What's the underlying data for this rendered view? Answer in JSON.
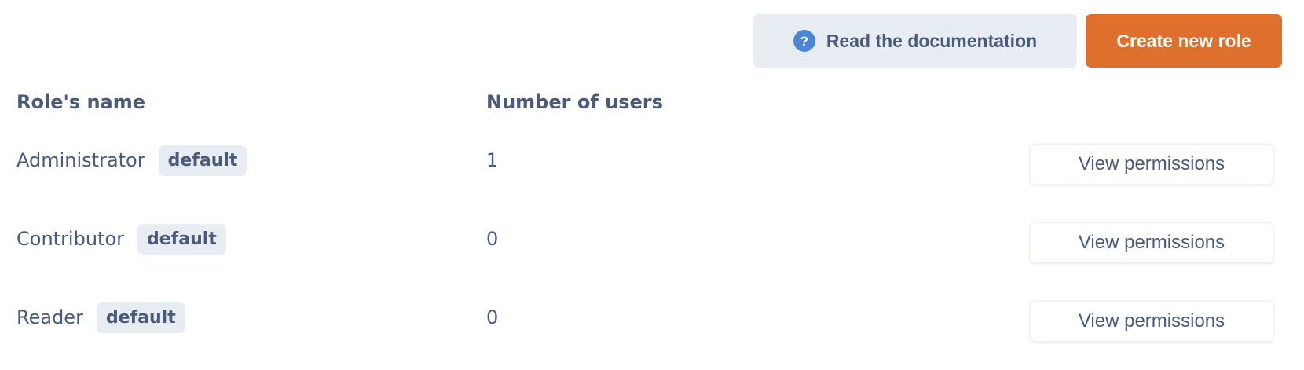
{
  "toolbar": {
    "documentation_label": "Read the documentation",
    "documentation_icon": "help-circle-icon",
    "documentation_icon_glyph": "?",
    "create_label": "Create new role"
  },
  "table": {
    "headers": {
      "name": "Role's name",
      "users": "Number of users"
    },
    "rows": [
      {
        "name": "Administrator",
        "badge": "default",
        "users": "1",
        "action": "View permissions"
      },
      {
        "name": "Contributor",
        "badge": "default",
        "users": "0",
        "action": "View permissions"
      },
      {
        "name": "Reader",
        "badge": "default",
        "users": "0",
        "action": "View permissions"
      }
    ]
  },
  "colors": {
    "primary": "#de6f2c",
    "text": "#4b5a78",
    "neutral_bg": "#e8ecf3",
    "info_icon": "#4a86d6"
  }
}
